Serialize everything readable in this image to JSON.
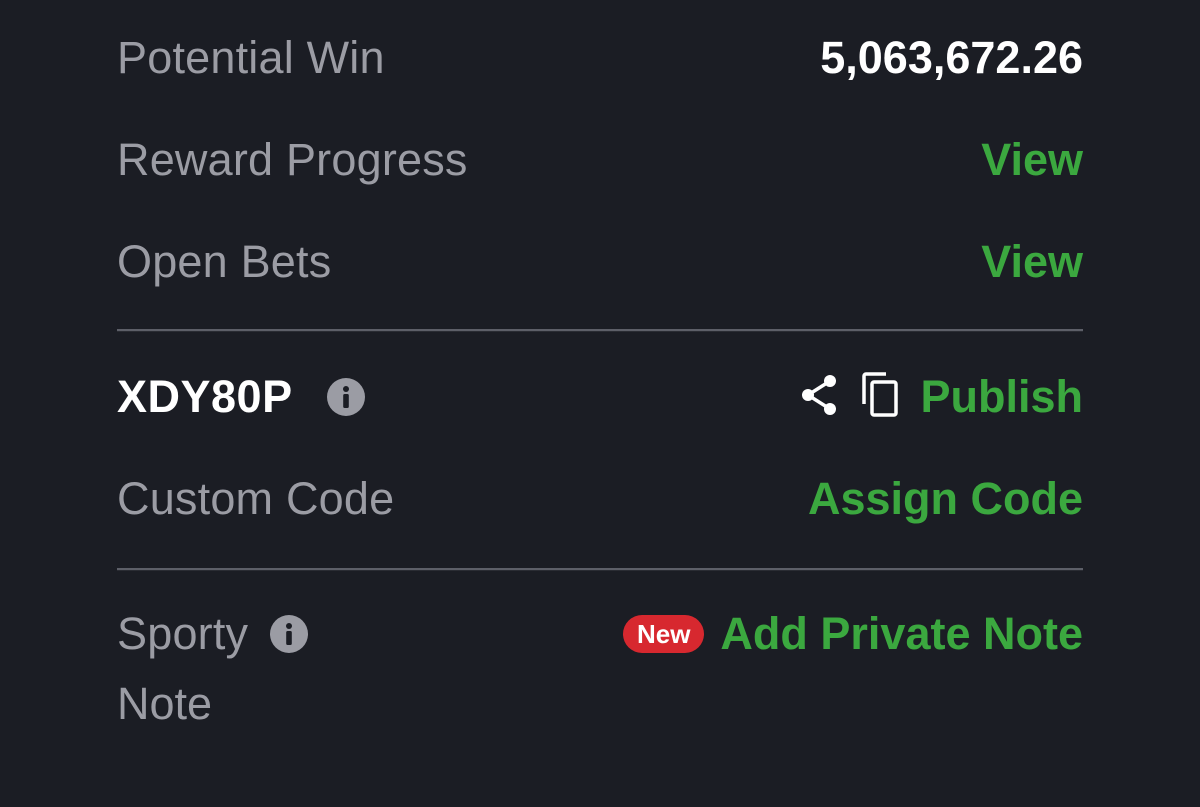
{
  "summary": {
    "potential_win_label": "Potential Win",
    "potential_win_value": "5,063,672.26",
    "reward_progress_label": "Reward Progress",
    "reward_progress_link": "View",
    "open_bets_label": "Open Bets",
    "open_bets_link": "View"
  },
  "booking": {
    "code": "XDY80P",
    "publish_label": "Publish",
    "custom_code_label": "Custom Code",
    "assign_code_label": "Assign Code"
  },
  "note": {
    "label_line1": "Sporty",
    "label_line2": "Note",
    "badge": "New",
    "add_note_label": "Add Private Note"
  },
  "icons": {
    "info": "info-icon",
    "share": "share-icon",
    "copy": "copy-icon"
  },
  "colors": {
    "background": "#1b1d24",
    "accent_green": "#3ba83f",
    "badge_red": "#d7282f",
    "label_gray": "#9b9ca4"
  }
}
